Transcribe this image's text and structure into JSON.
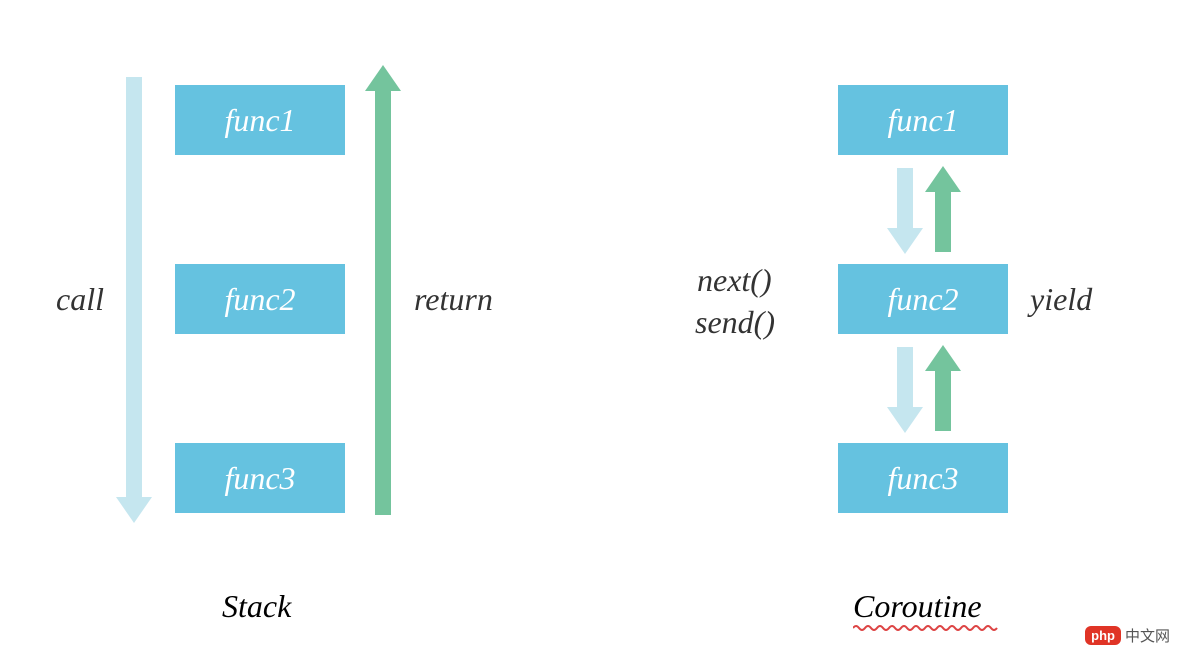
{
  "stack": {
    "title": "Stack",
    "boxes": [
      "func1",
      "func2",
      "func3"
    ],
    "leftLabel": "call",
    "rightLabel": "return"
  },
  "coroutine": {
    "title": "Coroutine",
    "boxes": [
      "func1",
      "func2",
      "func3"
    ],
    "leftLabel1": "next()",
    "leftLabel2": "send()",
    "rightLabel": "yield"
  },
  "watermark": {
    "badge": "php",
    "text": "中文网"
  },
  "colors": {
    "box": "#65c2e0",
    "lightArrow": "#c5e6ef",
    "greenArrow": "#74c49d"
  }
}
